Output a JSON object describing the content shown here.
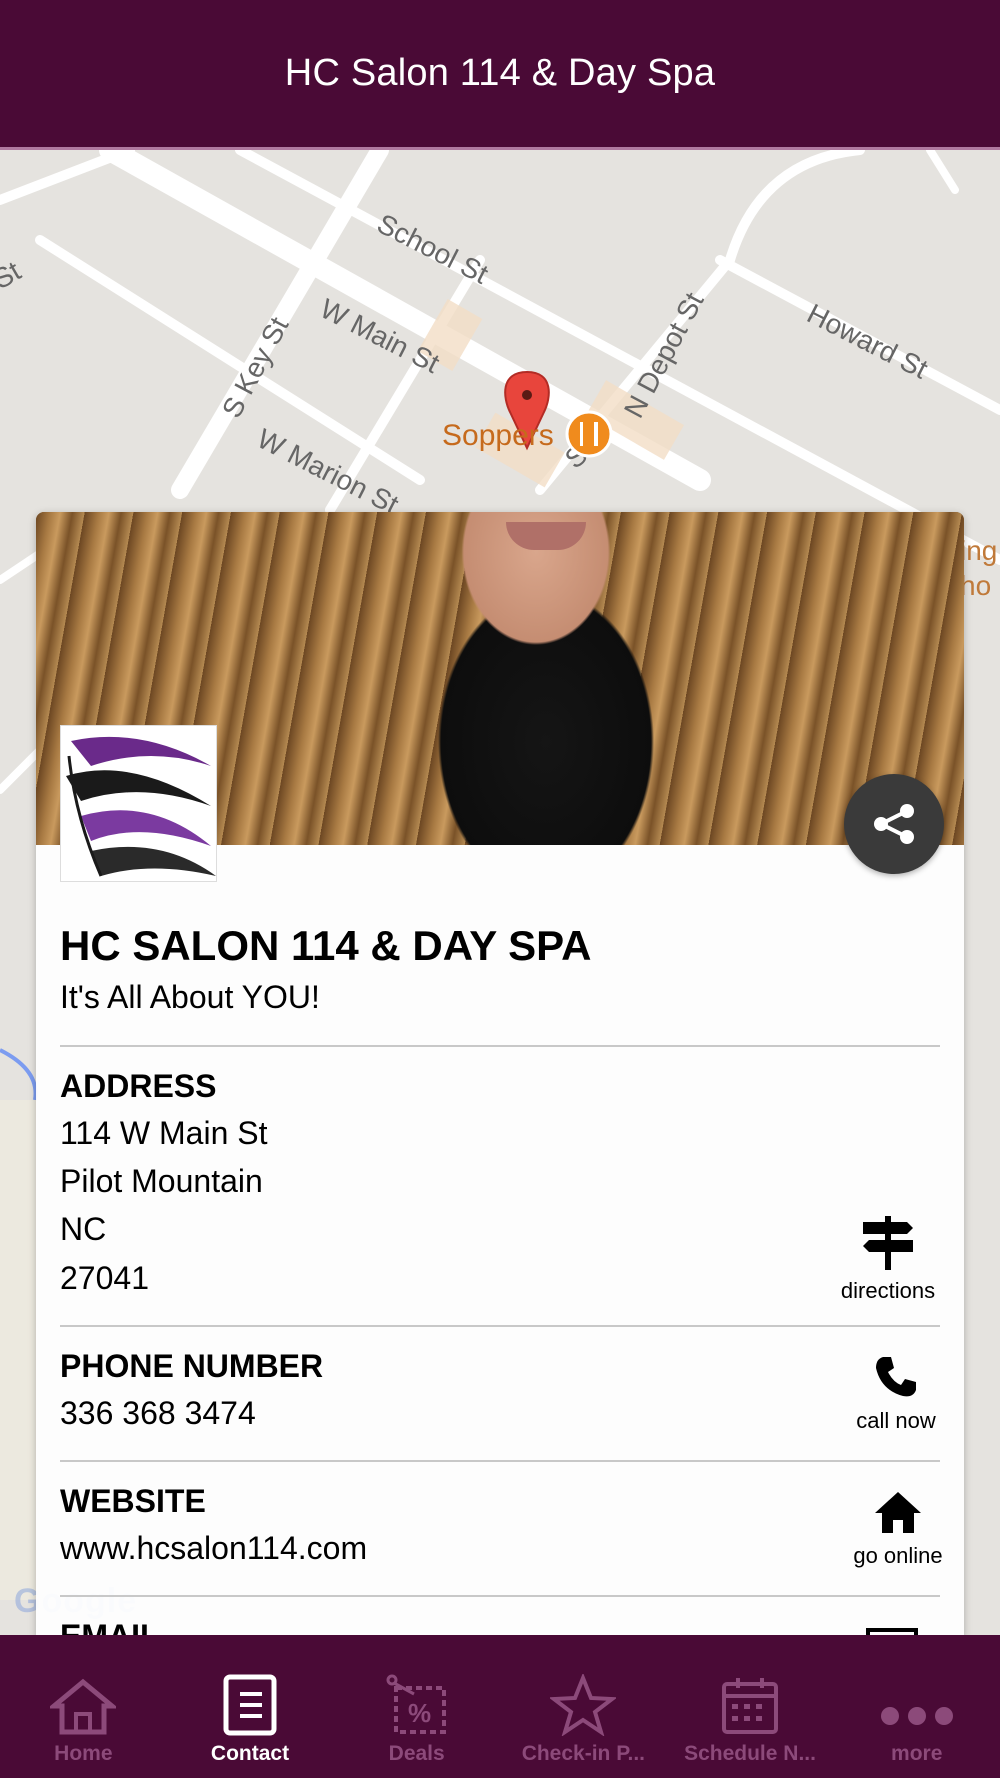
{
  "header": {
    "title": "HC Salon 114 & Day Spa"
  },
  "map": {
    "streets": [
      "School St",
      "Howard St",
      "W Main St",
      "S Key St",
      "N Depot St",
      "W Marion St",
      "St",
      "St"
    ],
    "poi": {
      "name": "Soppers",
      "icon": "restaurant-icon"
    },
    "attribution": "Google"
  },
  "business": {
    "name": "HC SALON 114 & DAY SPA",
    "tagline": "It's All About YOU!"
  },
  "address": {
    "label": "ADDRESS",
    "lines": [
      "114 W Main St",
      "Pilot Mountain",
      "NC",
      "27041"
    ],
    "action_label": "directions"
  },
  "phone": {
    "label": "PHONE NUMBER",
    "value": "336 368 3474",
    "action_label": "call now"
  },
  "website": {
    "label": "WEBSITE",
    "value": "www.hcsalon114.com",
    "action_label": "go online"
  },
  "email": {
    "label": "EMAIL"
  },
  "nav": {
    "items": [
      {
        "label": "Home",
        "icon": "home-icon",
        "active": false
      },
      {
        "label": "Contact",
        "icon": "contact-icon",
        "active": true
      },
      {
        "label": "Deals",
        "icon": "deals-icon",
        "active": false
      },
      {
        "label": "Check-in P...",
        "icon": "star-icon",
        "active": false
      },
      {
        "label": "Schedule N...",
        "icon": "calendar-icon",
        "active": false
      },
      {
        "label": "more",
        "icon": "more-icon",
        "active": false
      }
    ]
  },
  "colors": {
    "brand": "#4a0a36",
    "nav_inactive": "#8c4a7a",
    "nav_active": "#ffffff",
    "map_bg": "#e5e3df"
  }
}
